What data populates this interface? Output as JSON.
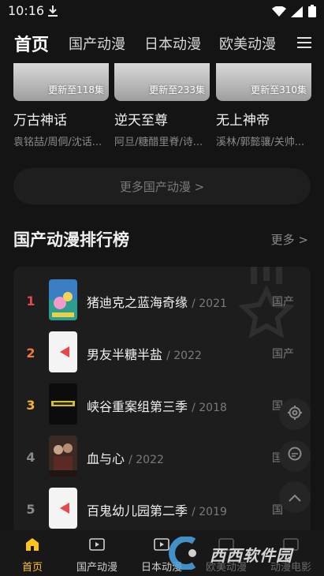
{
  "status_bar": {
    "time": "10:16"
  },
  "top_nav": {
    "tabs": [
      {
        "label": "首页",
        "active": true
      },
      {
        "label": "国产动漫"
      },
      {
        "label": "日本动漫"
      },
      {
        "label": "欧美动漫"
      }
    ]
  },
  "cards": [
    {
      "badge": "更新至118集",
      "title": "万古神话",
      "cast": "袁铭喆/周侗/沈话..."
    },
    {
      "badge": "更新至233集",
      "title": "逆天至尊",
      "cast": "阿旦/糖醋里脊/诗..."
    },
    {
      "badge": "更新至310集",
      "title": "无上神帝",
      "cast": "溪林/郭懿骧/关帅..."
    }
  ],
  "more_button": {
    "label": "更多国产动漫 >"
  },
  "section": {
    "title": "国产动漫排行榜",
    "more_label": "更多 >"
  },
  "ranking": [
    {
      "rank": "1",
      "title": "猪迪克之蓝海奇缘",
      "year": "/ 2021",
      "genre": "国产",
      "color": "#e5484d"
    },
    {
      "rank": "2",
      "title": "男友半糖半盐",
      "year": "/ 2022",
      "genre": "国产",
      "color": "#f07a3a"
    },
    {
      "rank": "3",
      "title": "峡谷重案组第三季",
      "year": "/ 2018",
      "genre": "国",
      "color": "#f4b42a"
    },
    {
      "rank": "4",
      "title": "血与心",
      "year": "/ 2022",
      "genre": "国",
      "color": "#8a8a8a"
    },
    {
      "rank": "5",
      "title": "百鬼幼儿园第二季",
      "year": "/ 2019",
      "genre": "国",
      "color": "#8a8a8a"
    }
  ],
  "bottom_nav": [
    {
      "label": "首页",
      "active": true
    },
    {
      "label": "国产动漫"
    },
    {
      "label": "日本动漫"
    },
    {
      "label": "欧美动漫"
    },
    {
      "label": "动漫电影"
    }
  ],
  "watermark": {
    "text": "西西软件园"
  },
  "colors": {
    "accent": "#ffc21a",
    "background": "#141414",
    "panel": "#1d1d1d"
  }
}
